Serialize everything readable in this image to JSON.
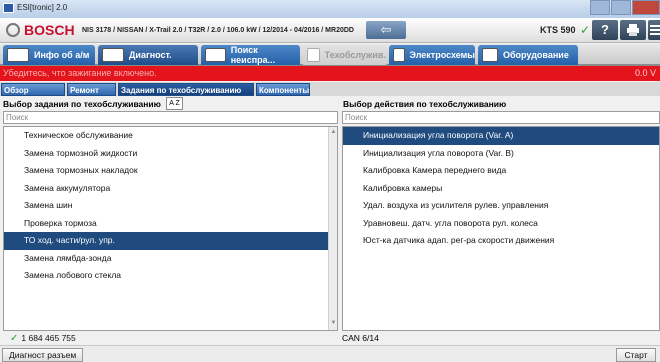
{
  "window": {
    "title": "ESI[tronic] 2.0"
  },
  "header": {
    "brand": "BOSCH",
    "vehicle": "NIS 3178 / NISSAN / X-Trail 2.0 / T32R / 2.0 / 106.0 kW / 12/2014 - 04/2016 / MR20DD",
    "back_icon": "⇦",
    "device": "KTS 590",
    "device_status_icon": "✓",
    "help_label": "?",
    "print_icon": "printer-icon",
    "menu_icon": "menu-icon"
  },
  "nav": {
    "tabs": [
      {
        "label": "Инфо об а/м",
        "state": "normal"
      },
      {
        "label": "Диагност.",
        "state": "active"
      },
      {
        "label": "Поиск неиспра...",
        "state": "normal"
      },
      {
        "label": "Техобслужив.",
        "state": "disabled"
      },
      {
        "label": "Электросхемы",
        "state": "normal"
      },
      {
        "label": "Оборудование",
        "state": "normal"
      }
    ]
  },
  "alert": {
    "text": "Убедитесь, что зажигание включено.",
    "value": "0.0 V"
  },
  "subtabs": [
    {
      "label": "Обзор системы"
    },
    {
      "label": "Ремонт"
    },
    {
      "label": "Задания по техобслуживанию"
    },
    {
      "label": "Компоненты"
    }
  ],
  "left_panel": {
    "title": "Выбор задания по техобслуживанию",
    "sort_label": "A Z",
    "search_placeholder": "Поиск",
    "items": [
      "Техническое обслуживание",
      "Замена тормозной жидкости",
      "Замена тормозных накладок",
      "Замена аккумулятора",
      "Замена шин",
      "Проверка тормоза",
      "ТО ход. части/рул. упр.",
      "Замена лямбда-зонда",
      "Замена лобового стекла"
    ],
    "selected_index": 6
  },
  "right_panel": {
    "title": "Выбор действия по техобслуживанию",
    "search_placeholder": "Поиск",
    "items": [
      "Инициализация угла поворота (Var. A)",
      "Инициализация угла поворота (Var. B)",
      "Калибровка Камера переднего вида",
      "Калибровка камеры",
      "Удал. воздуха из усилителя рулев. управления",
      "Уравновеш. датч. угла поворота рул. колеса",
      "Юст-ка датчика адап. рег-ра скорости движения"
    ],
    "selected_index": 0
  },
  "status": {
    "part_number": "1 684 465 755",
    "can": "CAN 6/14"
  },
  "bottom": {
    "connector_button": "Диагност разъем",
    "start_button": "Старт"
  },
  "colors": {
    "alert_bg": "#e3141b",
    "selection": "#1f4b7f",
    "brand": "#c8102e"
  }
}
